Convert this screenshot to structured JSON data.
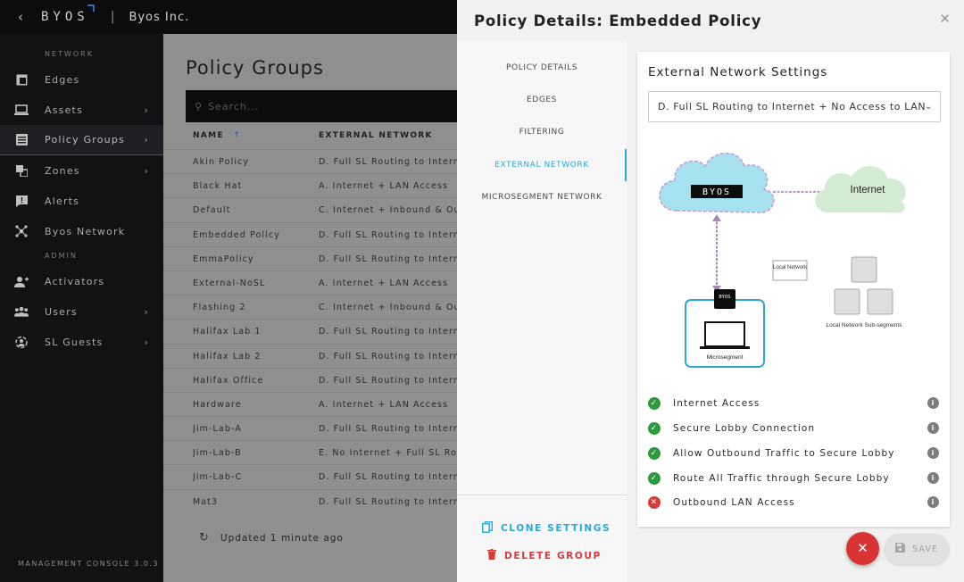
{
  "topbar": {
    "back_icon": "chevron-left-icon",
    "logo": "BYOS",
    "org": "Byos Inc."
  },
  "sidebar": {
    "sections": [
      {
        "label": "NETWORK",
        "items": [
          {
            "label": "Edges",
            "icon": "edge-icon",
            "has_chevron": false
          },
          {
            "label": "Assets",
            "icon": "laptop-icon",
            "has_chevron": true
          },
          {
            "label": "Policy Groups",
            "icon": "policy-list-icon",
            "has_chevron": true,
            "active": true
          },
          {
            "label": "Zones",
            "icon": "zones-icon",
            "has_chevron": true
          },
          {
            "label": "Alerts",
            "icon": "alert-icon",
            "has_chevron": false
          },
          {
            "label": "Byos Network",
            "icon": "network-icon",
            "has_chevron": false
          }
        ]
      },
      {
        "label": "ADMIN",
        "items": [
          {
            "label": "Activators",
            "icon": "activator-icon",
            "has_chevron": false
          },
          {
            "label": "Users",
            "icon": "users-icon",
            "has_chevron": true
          },
          {
            "label": "SL Guests",
            "icon": "guests-icon",
            "has_chevron": true
          }
        ]
      }
    ],
    "footer": "MANAGEMENT CONSOLE 3.0.3"
  },
  "main": {
    "title": "Policy Groups",
    "search_placeholder": "Search...",
    "columns": [
      "NAME",
      "EXTERNAL NETWORK"
    ],
    "sort_indicator": "↑",
    "rows": [
      [
        "Akin Policy",
        "D. Full SL Routing to Internet"
      ],
      [
        "Black Hat",
        "A. Internet + LAN Access"
      ],
      [
        "Default",
        "C. Internet + Inbound & Outbound"
      ],
      [
        "Embedded Policy",
        "D. Full SL Routing to Internet"
      ],
      [
        "EmmaPolicy",
        "D. Full SL Routing to Internet"
      ],
      [
        "External-NoSL",
        "A. Internet + LAN Access"
      ],
      [
        "Flashing 2",
        "C. Internet + Inbound & Outbound"
      ],
      [
        "Halifax Lab 1",
        "D. Full SL Routing to Internet"
      ],
      [
        "Halifax Lab 2",
        "D. Full SL Routing to Internet"
      ],
      [
        "Halifax Office",
        "D. Full SL Routing to Internet"
      ],
      [
        "Hardware",
        "A. Internet + LAN Access"
      ],
      [
        "Jim-Lab-A",
        "D. Full SL Routing to Internet"
      ],
      [
        "Jim-Lab-B",
        "E. No Internet + Full SL Routing"
      ],
      [
        "Jim-Lab-C",
        "D. Full SL Routing to Internet"
      ],
      [
        "Mat3",
        "D. Full SL Routing to Internet"
      ]
    ],
    "updated": "Updated 1 minute ago"
  },
  "panel": {
    "title": "Policy Details: Embedded Policy",
    "tabs": [
      "POLICY DETAILS",
      "EDGES",
      "FILTERING",
      "EXTERNAL NETWORK",
      "MICROSEGMENT NETWORK"
    ],
    "active_tab": "EXTERNAL NETWORK",
    "clone_label": "CLONE SETTINGS",
    "delete_label": "DELETE GROUP",
    "section_title": "External Network Settings",
    "selected_option": "D. Full SL Routing to Internet + No Access to LAN",
    "diagram": {
      "byos_label": "BYOS",
      "internet_label": "Internet",
      "local_network_label": "Local Network",
      "subsegments_label": "Local Network Sub-segments",
      "microsegment_label": "Microsegment",
      "badge_label": "BYOS"
    },
    "features": [
      {
        "label": "Internet Access",
        "enabled": true
      },
      {
        "label": "Secure Lobby Connection",
        "enabled": true
      },
      {
        "label": "Allow Outbound Traffic to Secure Lobby",
        "enabled": true
      },
      {
        "label": "Route All Traffic through Secure Lobby",
        "enabled": true
      },
      {
        "label": "Outbound LAN Access",
        "enabled": false
      }
    ],
    "save_label": "SAVE",
    "colors": {
      "accent": "#2aa8d6",
      "danger": "#d83434",
      "success": "#2e9a3e"
    }
  }
}
